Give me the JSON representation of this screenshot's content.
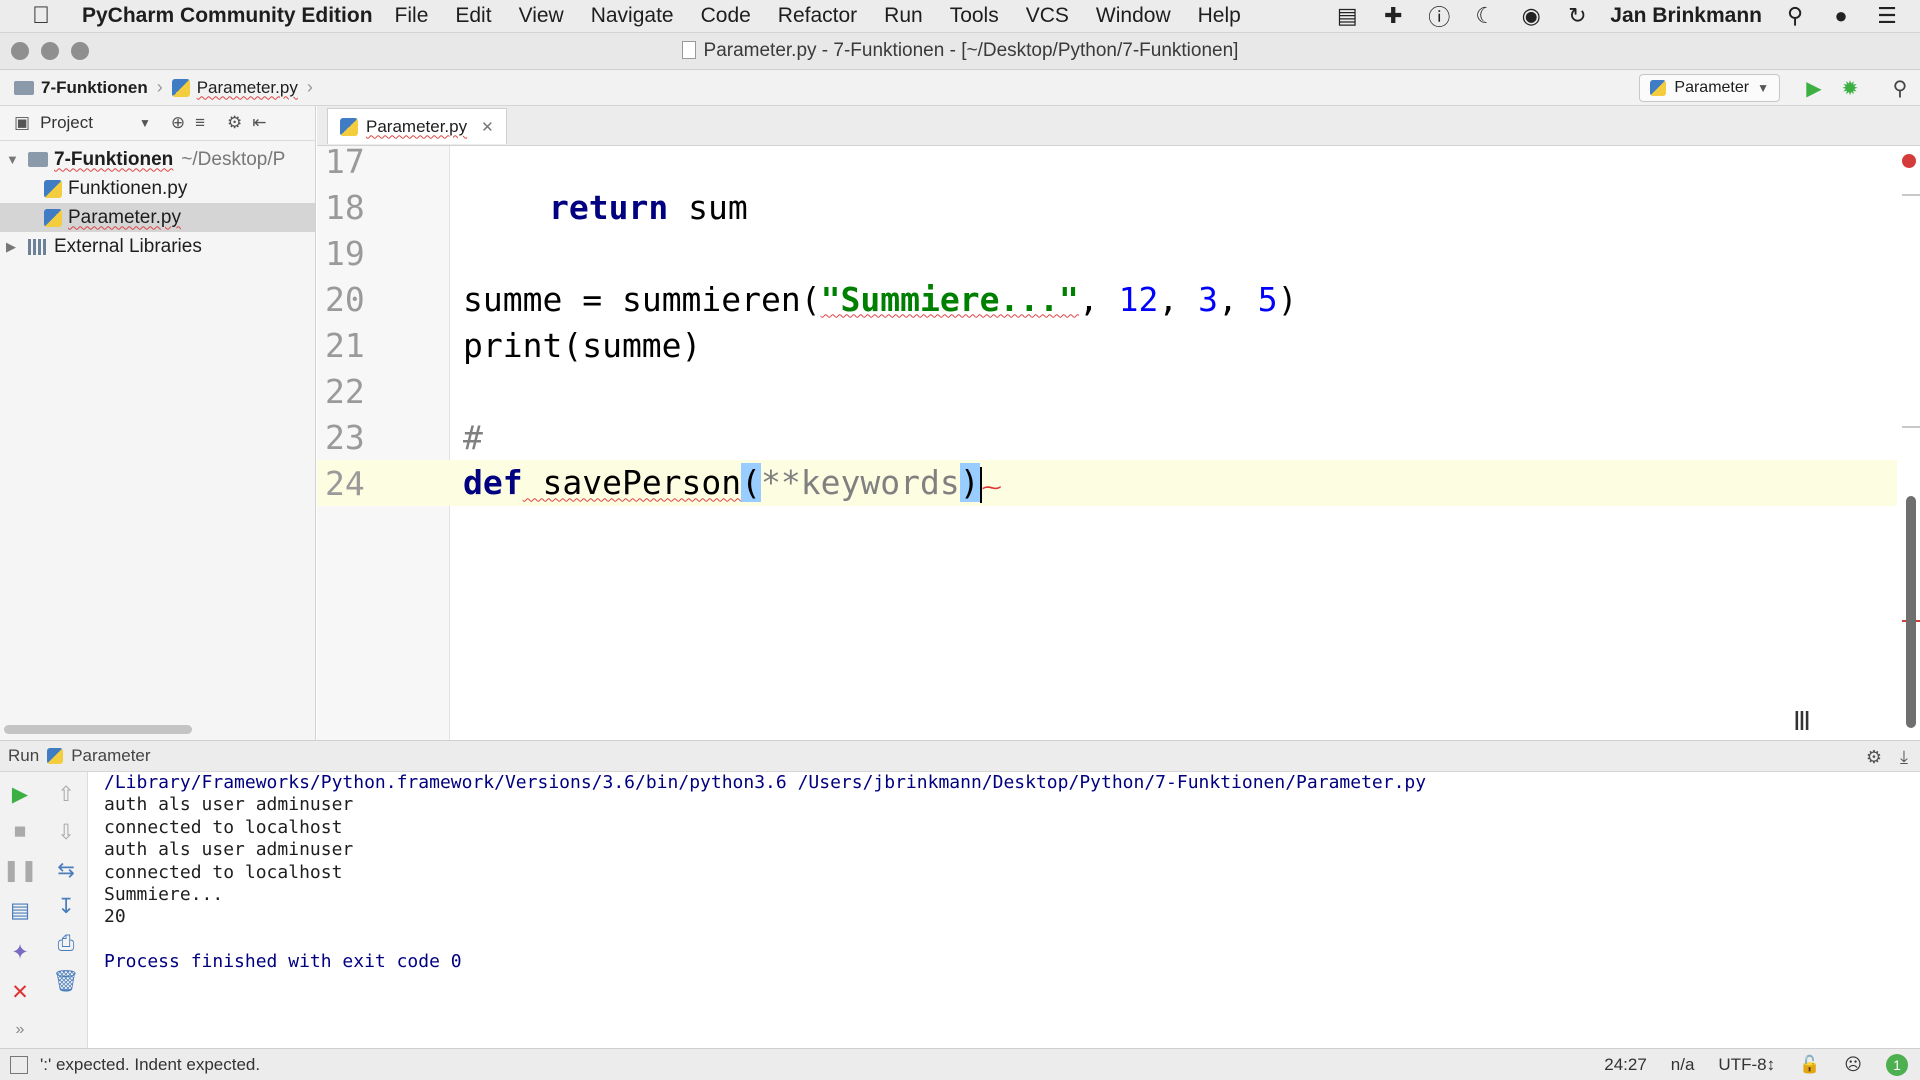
{
  "menubar": {
    "app_name": "PyCharm Community Edition",
    "items": [
      "File",
      "Edit",
      "View",
      "Navigate",
      "Code",
      "Refactor",
      "Run",
      "Tools",
      "VCS",
      "Window",
      "Help"
    ],
    "user": "Jan Brinkmann"
  },
  "window": {
    "title": "Parameter.py - 7-Funktionen - [~/Desktop/Python/7-Funktionen]"
  },
  "navbar": {
    "breadcrumb_folder": "7-Funktionen",
    "breadcrumb_file": "Parameter.py",
    "run_config": "Parameter"
  },
  "project": {
    "title": "Project",
    "tree": {
      "root": "7-Funktionen",
      "root_path": "~/Desktop/P",
      "files": [
        "Funktionen.py",
        "Parameter.py"
      ],
      "external": "External Libraries"
    }
  },
  "editor": {
    "tab_label": "Parameter.py",
    "lines": [
      {
        "num": "17"
      },
      {
        "num": "18",
        "kw": "return",
        "rest": " sum"
      },
      {
        "num": "19"
      },
      {
        "num": "20",
        "name": "summe",
        "op": " = ",
        "func": "summieren(",
        "str": "\"Summiere...\"",
        "sep1": ", ",
        "n1": "12",
        "sep2": ", ",
        "n2": "3",
        "sep3": ", ",
        "n3": "5",
        "close": ")"
      },
      {
        "num": "21",
        "func": "print(summe)"
      },
      {
        "num": "22"
      },
      {
        "num": "23",
        "comment": "#"
      },
      {
        "num": "24",
        "kw": "def",
        "fname": " savePerson",
        "open": "(",
        "param": "**keywords",
        "close": ")"
      }
    ]
  },
  "run": {
    "header_label": "Run",
    "config_name": "Parameter",
    "console": [
      "/Library/Frameworks/Python.framework/Versions/3.6/bin/python3.6 /Users/jbrinkmann/Desktop/Python/7-Funktionen/Parameter.py",
      "auth als user adminuser",
      "connected to localhost",
      "auth als user adminuser",
      "connected to localhost",
      "Summiere...",
      "20",
      "",
      "Process finished with exit code 0"
    ]
  },
  "status": {
    "message": "':' expected. Indent expected.",
    "position": "24:27",
    "na": "n/a",
    "encoding": "UTF-8↕",
    "badge": "1"
  },
  "colors": {
    "keyword": "#000080",
    "string": "#008000",
    "number": "#0000ff",
    "error": "#d43c3c",
    "run_green": "#3cb043"
  }
}
